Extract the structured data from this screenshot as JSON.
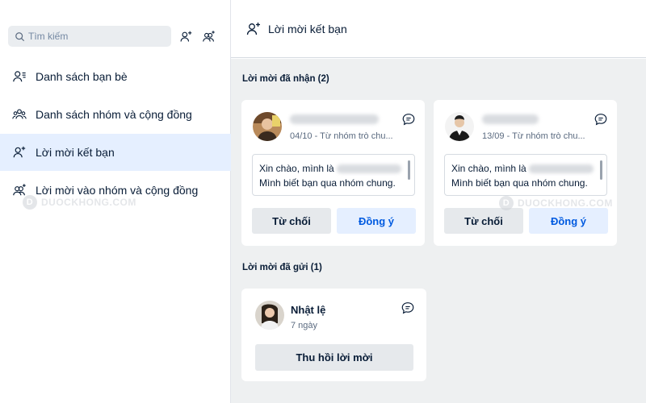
{
  "search": {
    "placeholder": "Tìm kiếm"
  },
  "sidebar": {
    "items": [
      {
        "label": "Danh sách bạn bè"
      },
      {
        "label": "Danh sách nhóm và cộng đồng"
      },
      {
        "label": "Lời mời kết bạn"
      },
      {
        "label": "Lời mời vào nhóm và cộng đồng"
      }
    ]
  },
  "header": {
    "title": "Lời mời kết bạn"
  },
  "received": {
    "title": "Lời mời đã nhận (2)",
    "cards": [
      {
        "meta": "04/10 - Từ nhóm trò chu...",
        "msg_line1": "Xin chào, mình là",
        "msg_line2": "Mình biết bạn qua nhóm chung.",
        "reject_label": "Từ chối",
        "accept_label": "Đồng ý"
      },
      {
        "meta": "13/09 - Từ nhóm trò chu...",
        "msg_line1": "Xin chào, mình là",
        "msg_line2": "Mình biết bạn qua nhóm chung.",
        "reject_label": "Từ chối",
        "accept_label": "Đồng ý"
      }
    ]
  },
  "sent": {
    "title": "Lời mời đã gửi (1)",
    "cards": [
      {
        "name": "Nhật lệ",
        "meta": "7 ngày",
        "recall_label": "Thu hồi lời mời"
      }
    ]
  },
  "watermark": {
    "text": "DUOCKHONG.COM",
    "letter": "D"
  },
  "icons": {
    "search": "search-icon",
    "add_friend": "add-friend-icon",
    "create_group": "create-group-icon",
    "friend_list": "friend-list-icon",
    "group_list": "group-list-icon",
    "friend_request": "friend-request-icon",
    "group_invite": "group-invite-icon",
    "chat": "chat-icon"
  },
  "colors": {
    "accent": "#005ae0",
    "active_bg": "#e5efff",
    "panel_bg": "#eef0f1"
  }
}
